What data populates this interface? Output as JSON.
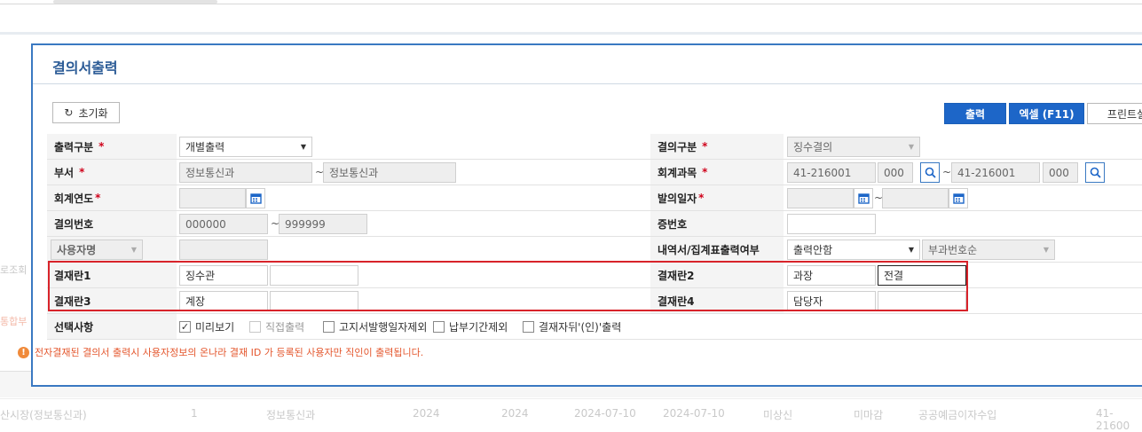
{
  "background": {
    "left_frag_1": "로조회",
    "left_frag_2": "통합부",
    "row": [
      "산시장(정보통신과)",
      "1",
      "정보통신과",
      "2024",
      "2024",
      "2024-07-10",
      "2024-07-10",
      "미상신",
      "미마감",
      "공공예금이자수입",
      "41-21600"
    ]
  },
  "dialog": {
    "title": "결의서출력",
    "reset_label": "초기화",
    "print_label": "출력",
    "excel_label": "엑셀 (F11)",
    "printset_label": "프린트설"
  },
  "form": {
    "output_type": {
      "label": "출력구분",
      "value": "개별출력"
    },
    "resolution_type": {
      "label": "결의구분",
      "value": "징수결의"
    },
    "dept": {
      "label": "부서",
      "from": "정보통신과",
      "to": "정보통신과"
    },
    "account": {
      "label": "회계과목",
      "from": "41-216001",
      "from_sub": "000",
      "to": "41-216001",
      "to_sub": "000"
    },
    "fiscal_year": {
      "label": "회계연도"
    },
    "issue_date": {
      "label": "발의일자"
    },
    "resolution_no": {
      "label": "결의번호",
      "from": "000000",
      "to": "999999"
    },
    "cert_no": {
      "label": "증번호",
      "value": ""
    },
    "user_select": {
      "value": "사용자명"
    },
    "detail_output": {
      "label": "내역서/집계표출력여부",
      "value": "출력안함",
      "sort_value": "부과번호순"
    },
    "approval1": {
      "label": "결재란1",
      "value1": "징수관",
      "value2": ""
    },
    "approval2": {
      "label": "결재란2",
      "value1": "과장",
      "value2": "전결"
    },
    "approval3": {
      "label": "결재란3",
      "value1": "계장",
      "value2": ""
    },
    "approval4": {
      "label": "결재란4",
      "value1": "담당자",
      "value2": ""
    },
    "options": {
      "label": "선택사항",
      "preview": "미리보기",
      "direct_print": "직접출력",
      "notice_exclude": "고지서발행일자제외",
      "due_exclude": "납부기간제외",
      "stamp_print": "결재자뒤'(인)'출력"
    }
  },
  "notice": "전자결재된 결의서 출력시 사용자정보의 온나라 결재 ID 가 등록된 사용자만 직인이 출력됩니다.",
  "required_mark": "*"
}
